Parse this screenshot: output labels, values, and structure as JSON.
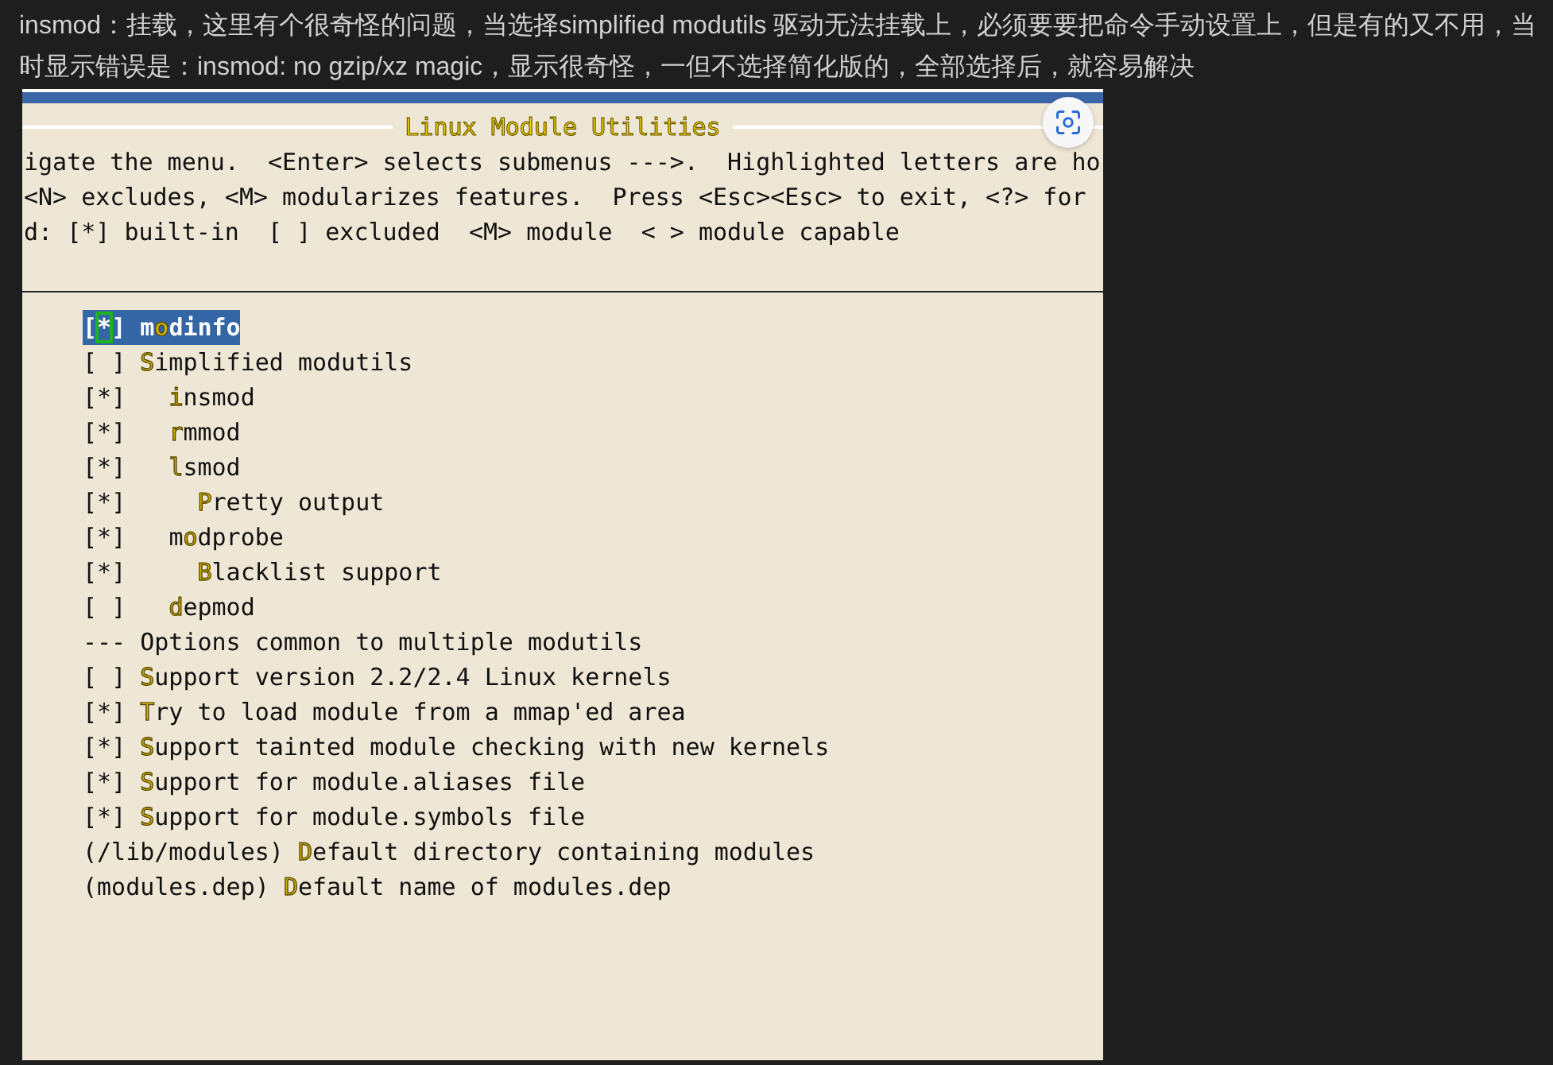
{
  "article": {
    "paragraph": "insmod：挂载，这里有个很奇怪的问题，当选择simplified modutils 驱动无法挂载上，必须要要把命令手动设置上，但是有的又不用，当时显示错误是：insmod: no gzip/xz magic，显示很奇怪，一但不选择简化版的，全部选择后，就容易解决"
  },
  "terminal": {
    "title": "Linux Module Utilities",
    "help_lines": [
      "igate the menu.  <Enter> selects submenus --->.  Highlighted letters are ho",
      "<N> excludes, <M> modularizes features.  Press <Esc><Esc> to exit, <?> for",
      "d: [*] built-in  [ ] excluded  <M> module  < > module capable"
    ],
    "symbols": {
      "open": "[",
      "close": "]",
      "on": "*"
    },
    "items": [
      {
        "kind": "bool",
        "checked": true,
        "selected": true,
        "before": "m",
        "hotkey": "o",
        "after": "dinfo"
      },
      {
        "kind": "bool",
        "checked": false,
        "selected": false,
        "hotkey": "S",
        "after": "implified modutils",
        "children": [
          {
            "kind": "bool",
            "checked": true,
            "selected": false,
            "hotkey": "i",
            "after": "nsmod"
          },
          {
            "kind": "bool",
            "checked": true,
            "selected": false,
            "hotkey": "r",
            "after": "mmod"
          },
          {
            "kind": "bool",
            "checked": true,
            "selected": false,
            "hotkey": "l",
            "after": "smod",
            "children": [
              {
                "kind": "bool",
                "checked": true,
                "selected": false,
                "hotkey": "P",
                "after": "retty output"
              }
            ]
          },
          {
            "kind": "bool",
            "checked": true,
            "selected": false,
            "before": "m",
            "hotkey": "o",
            "after": "dprobe",
            "children": [
              {
                "kind": "bool",
                "checked": true,
                "selected": false,
                "hotkey": "B",
                "after": "lacklist support"
              }
            ]
          },
          {
            "kind": "bool",
            "checked": false,
            "selected": false,
            "hotkey": "d",
            "after": "epmod"
          }
        ]
      },
      {
        "kind": "comment",
        "selected": false,
        "text": "--- Options common to multiple modutils"
      },
      {
        "kind": "bool",
        "checked": false,
        "selected": false,
        "hotkey": "S",
        "after": "upport version 2.2/2.4 Linux kernels"
      },
      {
        "kind": "bool",
        "checked": true,
        "selected": false,
        "hotkey": "T",
        "after": "ry to load module from a mmap'ed area"
      },
      {
        "kind": "bool",
        "checked": true,
        "selected": false,
        "hotkey": "S",
        "after": "upport tainted module checking with new kernels"
      },
      {
        "kind": "bool",
        "checked": true,
        "selected": false,
        "hotkey": "S",
        "after": "upport for module.aliases file"
      },
      {
        "kind": "bool",
        "checked": true,
        "selected": false,
        "hotkey": "S",
        "after": "upport for module.symbols file"
      },
      {
        "kind": "string",
        "selected": false,
        "value": "(/lib/modules)",
        "hotkey": "D",
        "after": "efault directory containing modules"
      },
      {
        "kind": "string",
        "selected": false,
        "value": "(modules.dep)",
        "hotkey": "D",
        "after": "efault name of modules.dep"
      }
    ]
  }
}
